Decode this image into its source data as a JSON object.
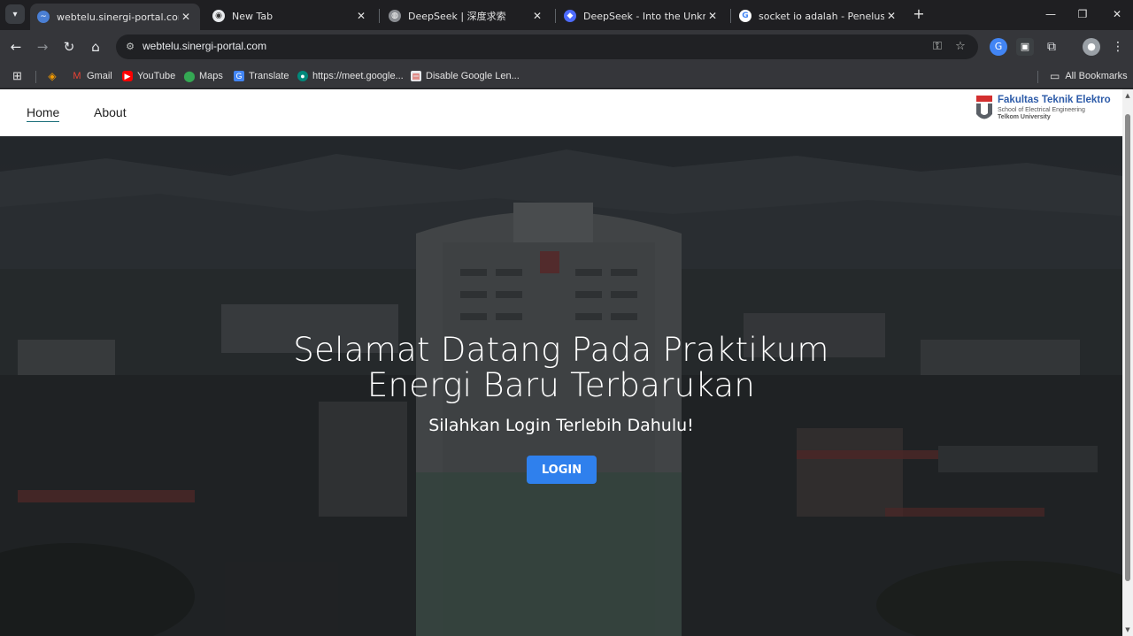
{
  "browser": {
    "tabs": [
      {
        "title": "webtelu.sinergi-portal.com",
        "favicon": "edge-wave-icon",
        "active": true
      },
      {
        "title": "New Tab",
        "favicon": "chrome-icon",
        "active": false
      },
      {
        "title": "DeepSeek | 深度求索",
        "favicon": "globe-icon",
        "active": false
      },
      {
        "title": "DeepSeek - Into the Unknown",
        "favicon": "deepseek-whale-icon",
        "active": false
      },
      {
        "title": "socket io adalah - Penelusuran",
        "favicon": "google-icon",
        "active": false
      }
    ],
    "url": "webtelu.sinergi-portal.com",
    "bookmarks": [
      {
        "label": "",
        "icon": "diamond-icon"
      },
      {
        "label": "Gmail",
        "icon": "gmail-icon"
      },
      {
        "label": "YouTube",
        "icon": "youtube-icon"
      },
      {
        "label": "Maps",
        "icon": "maps-icon"
      },
      {
        "label": "Translate",
        "icon": "translate-icon"
      },
      {
        "label": "https://meet.google...",
        "icon": "meet-icon"
      },
      {
        "label": "Disable Google Len...",
        "icon": "extension-page-icon"
      }
    ],
    "all_bookmarks_label": "All Bookmarks"
  },
  "site": {
    "nav": {
      "home": "Home",
      "about": "About"
    },
    "logo": {
      "title": "Fakultas Teknik Elektro",
      "subtitle1": "School of Electrical Engineering",
      "subtitle2": "Telkom University"
    },
    "hero": {
      "title_line1": "Selamat Datang Pada Praktikum",
      "title_line2": "Energi Baru Terbarukan",
      "subtitle": "Silahkan Login Terlebih Dahulu!",
      "login_label": "LOGIN"
    }
  },
  "colors": {
    "accent": "#2f80ed",
    "logo_blue": "#2d5ba8",
    "logo_red": "#d32f2f",
    "chrome_dark": "#35363a"
  }
}
